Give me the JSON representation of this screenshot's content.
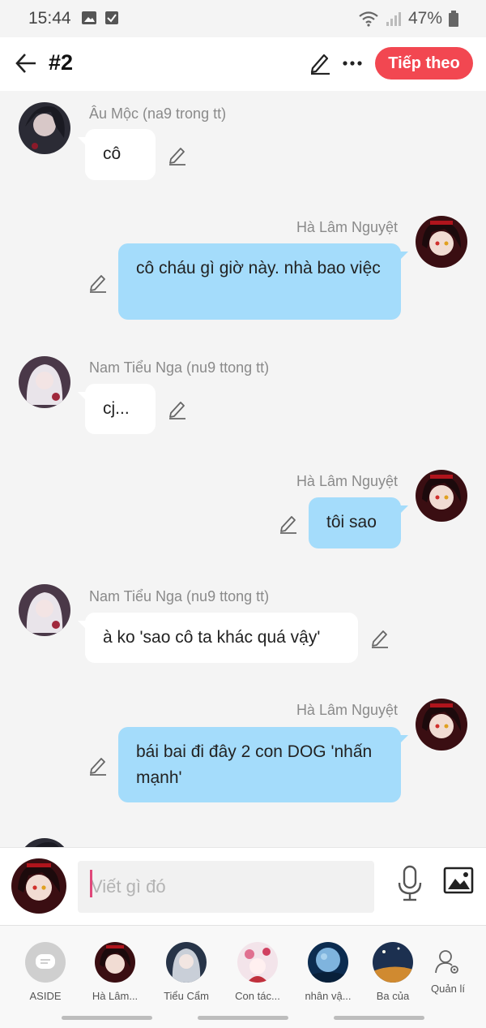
{
  "status_bar": {
    "time": "15:44",
    "battery": "47%"
  },
  "header": {
    "title": "#2",
    "next_button": "Tiếp theo"
  },
  "messages": [
    {
      "side": "left",
      "sender": "Âu Mộc (na9 trong tt)",
      "text": "cô",
      "avatar": "dark-hair-avatar"
    },
    {
      "side": "right",
      "sender": "Hà Lâm Nguyệt",
      "text": "cô cháu gì giờ này. nhà bao việc",
      "avatar": "red-eye-avatar"
    },
    {
      "side": "left",
      "sender": "Nam Tiểu Nga (nu9 ttong tt)",
      "text": "cj...",
      "avatar": "white-hair-avatar"
    },
    {
      "side": "right",
      "sender": "Hà Lâm Nguyệt",
      "text": "tôi sao",
      "avatar": "red-eye-avatar"
    },
    {
      "side": "left",
      "sender": "Nam Tiểu Nga (nu9 ttong tt)",
      "text": "à ko 'sao cô ta khác quá vậy'",
      "avatar": "white-hair-avatar"
    },
    {
      "side": "right",
      "sender": "Hà Lâm Nguyệt",
      "text": "bái bai đi đây 2 con DOG 'nhấn mạnh'",
      "avatar": "red-eye-avatar"
    }
  ],
  "composer": {
    "placeholder": "Viết gì đó"
  },
  "bottom_bar": {
    "items": [
      {
        "label": "ASIDE",
        "icon": "aside-icon"
      },
      {
        "label": "Hà Lâm...",
        "icon": "red-eye-avatar"
      },
      {
        "label": "Tiểu Cẩm",
        "icon": "grey-hair-avatar"
      },
      {
        "label": "Con tác...",
        "icon": "flower-avatar"
      },
      {
        "label": "nhân vậ...",
        "icon": "moon-avatar"
      },
      {
        "label": "Ba của",
        "icon": "night-sky-avatar"
      },
      {
        "label": "Quản lí",
        "icon": "manage-user-icon"
      }
    ]
  },
  "colors": {
    "accent": "#f24751",
    "right_bubble": "#a4dcfb",
    "left_bubble": "#ffffff",
    "background": "#f4f4f4"
  }
}
